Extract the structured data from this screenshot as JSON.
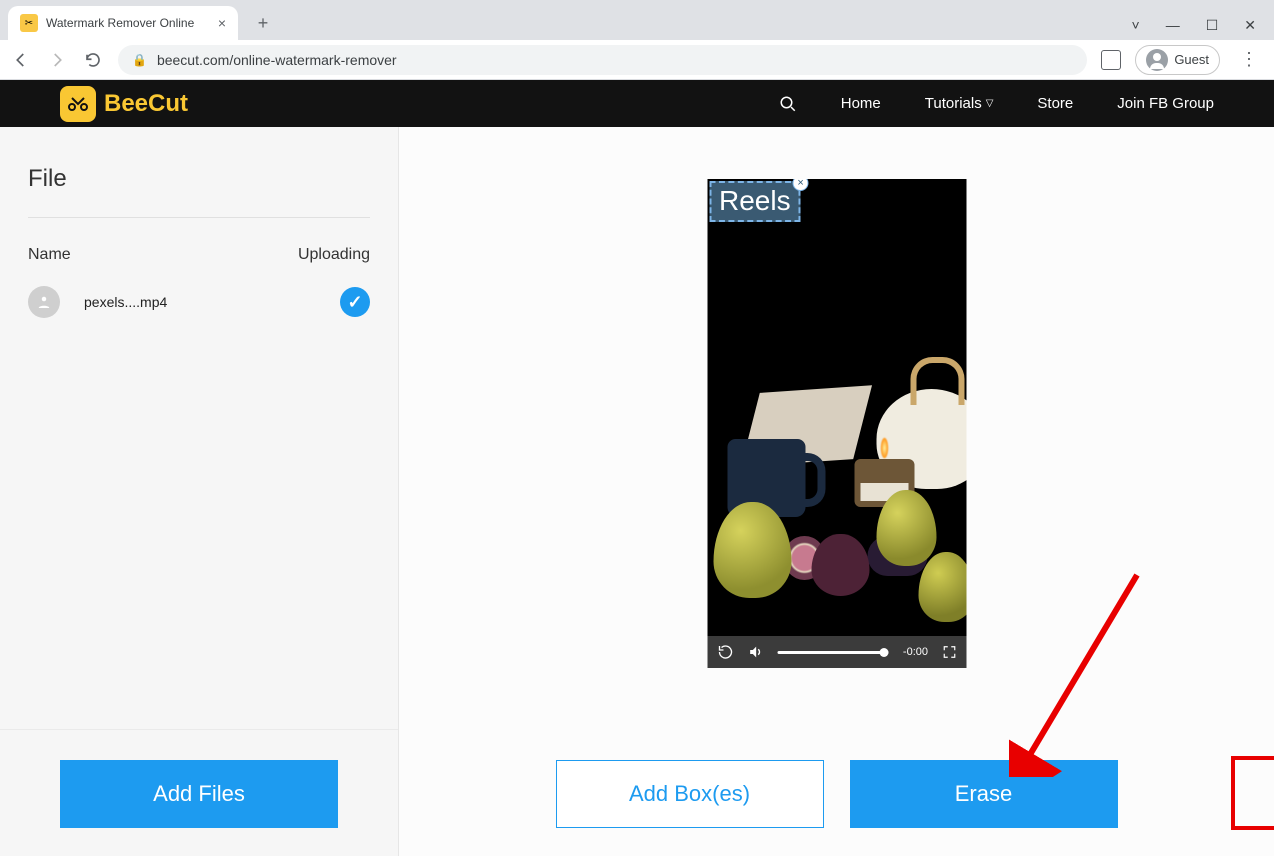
{
  "browser": {
    "tab_title": "Watermark Remover Online",
    "url": "beecut.com/online-watermark-remover",
    "guest_label": "Guest"
  },
  "header": {
    "brand": "BeeCut",
    "nav": {
      "home": "Home",
      "tutorials": "Tutorials",
      "store": "Store",
      "fbgroup": "Join FB Group"
    }
  },
  "sidebar": {
    "title": "File",
    "col_name": "Name",
    "col_upload": "Uploading",
    "file_name": "pexels....mp4",
    "add_files": "Add Files"
  },
  "preview": {
    "watermark_text": "Reels",
    "time_remaining": "-0:00"
  },
  "actions": {
    "add_boxes": "Add Box(es)",
    "erase": "Erase"
  }
}
